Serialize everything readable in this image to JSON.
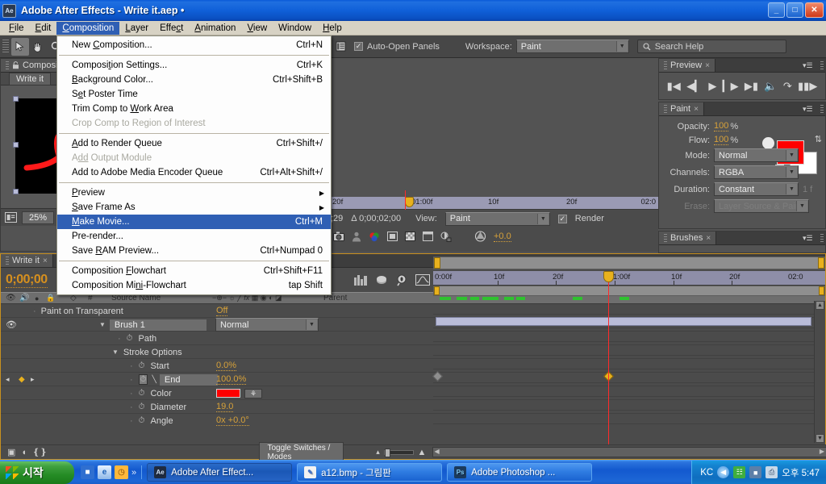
{
  "window": {
    "app_badge": "Ae",
    "title": "Adobe After Effects - Write it.aep •",
    "minimize": "_",
    "maximize": "□",
    "close": "✕"
  },
  "menubar": {
    "items": [
      {
        "label": "File",
        "accel": "F"
      },
      {
        "label": "Edit",
        "accel": "E"
      },
      {
        "label": "Composition",
        "accel": "C",
        "active": true
      },
      {
        "label": "Layer",
        "accel": "L"
      },
      {
        "label": "Effect",
        "accel": "c"
      },
      {
        "label": "Animation",
        "accel": "A"
      },
      {
        "label": "View",
        "accel": "V"
      },
      {
        "label": "Window",
        "accel": ""
      },
      {
        "label": "Help",
        "accel": "H"
      }
    ]
  },
  "composition_menu": {
    "groups": [
      [
        {
          "label": "New Composition...",
          "accel": "Ctrl+N",
          "enabled": true,
          "submenu": false,
          "highlight": false
        }
      ],
      [
        {
          "label": "Composition Settings...",
          "accel": "Ctrl+K",
          "enabled": true,
          "submenu": false,
          "highlight": false
        },
        {
          "label": "Background Color...",
          "accel": "Ctrl+Shift+B",
          "enabled": true,
          "submenu": false,
          "highlight": false
        },
        {
          "label": "Set Poster Time",
          "accel": "",
          "enabled": true,
          "submenu": false,
          "highlight": false
        },
        {
          "label": "Trim Comp to Work Area",
          "accel": "",
          "enabled": true,
          "submenu": false,
          "highlight": false
        },
        {
          "label": "Crop Comp to Region of Interest",
          "accel": "",
          "enabled": false,
          "submenu": false,
          "highlight": false
        }
      ],
      [
        {
          "label": "Add to Render Queue",
          "accel": "Ctrl+Shift+/",
          "enabled": true,
          "submenu": false,
          "highlight": false
        },
        {
          "label": "Add Output Module",
          "accel": "",
          "enabled": false,
          "submenu": false,
          "highlight": false
        },
        {
          "label": "Add to Adobe Media Encoder Queue",
          "accel": "Ctrl+Alt+Shift+/",
          "enabled": true,
          "submenu": false,
          "highlight": false
        }
      ],
      [
        {
          "label": "Preview",
          "accel": "",
          "enabled": true,
          "submenu": true,
          "highlight": false
        },
        {
          "label": "Save Frame As",
          "accel": "",
          "enabled": true,
          "submenu": true,
          "highlight": false
        },
        {
          "label": "Make Movie...",
          "accel": "Ctrl+M",
          "enabled": true,
          "submenu": false,
          "highlight": true
        },
        {
          "label": "Pre-render...",
          "accel": "",
          "enabled": true,
          "submenu": false,
          "highlight": false
        },
        {
          "label": "Save RAM Preview...",
          "accel": "Ctrl+Numpad 0",
          "enabled": true,
          "submenu": false,
          "highlight": false
        }
      ],
      [
        {
          "label": "Composition Flowchart",
          "accel": "Ctrl+Shift+F11",
          "enabled": true,
          "submenu": false,
          "highlight": false
        },
        {
          "label": "Composition Mini-Flowchart",
          "accel": "tap Shift",
          "enabled": true,
          "submenu": false,
          "highlight": false
        }
      ]
    ]
  },
  "toolbar": {
    "tools": [
      "selection-tool",
      "hand-tool",
      "zoom-tool"
    ],
    "auto_open_panels": "Auto-Open Panels",
    "auto_open_checked": true,
    "workspace_label": "Workspace:",
    "workspace_value": "Paint",
    "search_placeholder": "Search Help"
  },
  "comp_panel": {
    "tab": "Composition",
    "tab_close": "×",
    "subtab": "Write it",
    "zoom": "25%",
    "magnification_label": "25%"
  },
  "viewer": {
    "tab": "Composition",
    "zoom": "25%",
    "ruler_labels": [
      "20f",
      "01:00f",
      "10f",
      "20f",
      "02:0"
    ],
    "timecode_delta": "Δ 0;00;02;00",
    "frame_right": ";29",
    "view_label": "View:",
    "view_value": "Paint",
    "render_label": "Render",
    "render_checked": true,
    "exposure": "+0.0"
  },
  "preview_panel": {
    "tab": "Preview",
    "tab_close": "×",
    "buttons": [
      "first-frame",
      "previous-frame",
      "play",
      "next-frame",
      "last-frame",
      "audio",
      "loop",
      "ram-preview"
    ]
  },
  "paint_panel": {
    "tab": "Paint",
    "tab_close": "×",
    "opacity_label": "Opacity:",
    "opacity_value": "100",
    "opacity_unit": "%",
    "flow_label": "Flow:",
    "flow_value": "100",
    "flow_unit": "%",
    "brush_size": "19",
    "mode_label": "Mode:",
    "mode_value": "Normal",
    "channels_label": "Channels:",
    "channels_value": "RGBA",
    "duration_label": "Duration:",
    "duration_value": "Constant",
    "duration_frames": "1 f",
    "erase_label": "Erase:",
    "erase_value": "Layer Source & Paint",
    "foreground_color": "#ff0000",
    "background_color": "#ffffff"
  },
  "brushes_panel": {
    "tab": "Brushes",
    "tab_close": "×"
  },
  "timeline": {
    "tab": "Write it",
    "tab_close": "×",
    "timecode": "0;00;00",
    "columns": [
      "Source Name",
      "Parent"
    ],
    "hash": "#",
    "toggle_switches": "Toggle Switches / Modes",
    "rows": [
      {
        "name": "Paint on Transparent",
        "value": "Off",
        "indent": 40,
        "type": "plain",
        "dotted": true
      },
      {
        "name": "Brush 1",
        "value": "Normal",
        "indent": 36,
        "type": "layer",
        "dotted": false
      },
      {
        "name": "Path",
        "value": "",
        "indent": 56,
        "type": "prop",
        "dotted": false
      },
      {
        "name": "Stroke Options",
        "value": "",
        "indent": 48,
        "type": "group",
        "dotted": false
      },
      {
        "name": "Start",
        "value": "0.0%",
        "indent": 62,
        "type": "prop",
        "dotted": true
      },
      {
        "name": "End",
        "value": "100.0%",
        "indent": 62,
        "type": "prop-selected",
        "dotted": true
      },
      {
        "name": "Color",
        "value": "",
        "indent": 62,
        "type": "color",
        "dotted": false
      },
      {
        "name": "Diameter",
        "value": "19.0",
        "indent": 62,
        "type": "prop",
        "dotted": true
      },
      {
        "name": "Angle",
        "value": "0x +0.0°",
        "indent": 62,
        "type": "prop",
        "dotted": true
      }
    ],
    "ruler_labels": [
      "0:00f",
      "10f",
      "20f",
      "1:00f",
      "10f",
      "20f",
      "02:0"
    ],
    "accent_color": "#c8901f",
    "keyframe_color": "#e8b11e",
    "playhead_color": "#ff2a2a"
  },
  "taskbar": {
    "start_label": "시작",
    "quicklaunch": [
      "show-desktop-icon",
      "internet-explorer-icon",
      "clock-icon"
    ],
    "quicklaunch_more": "»",
    "items": [
      {
        "label": "Adobe After Effect...",
        "icon": "Ae",
        "active": true
      },
      {
        "label": "a12.bmp - 그림판",
        "icon": "✎",
        "active": false
      },
      {
        "label": "Adobe Photoshop ...",
        "icon": "Ps",
        "active": false
      }
    ],
    "tray_text": "KC",
    "tray_icons": [
      "back-arrow-icon",
      "network-icon",
      "monitor-icon",
      "printer-icon"
    ],
    "clock": "오후 5:47"
  }
}
